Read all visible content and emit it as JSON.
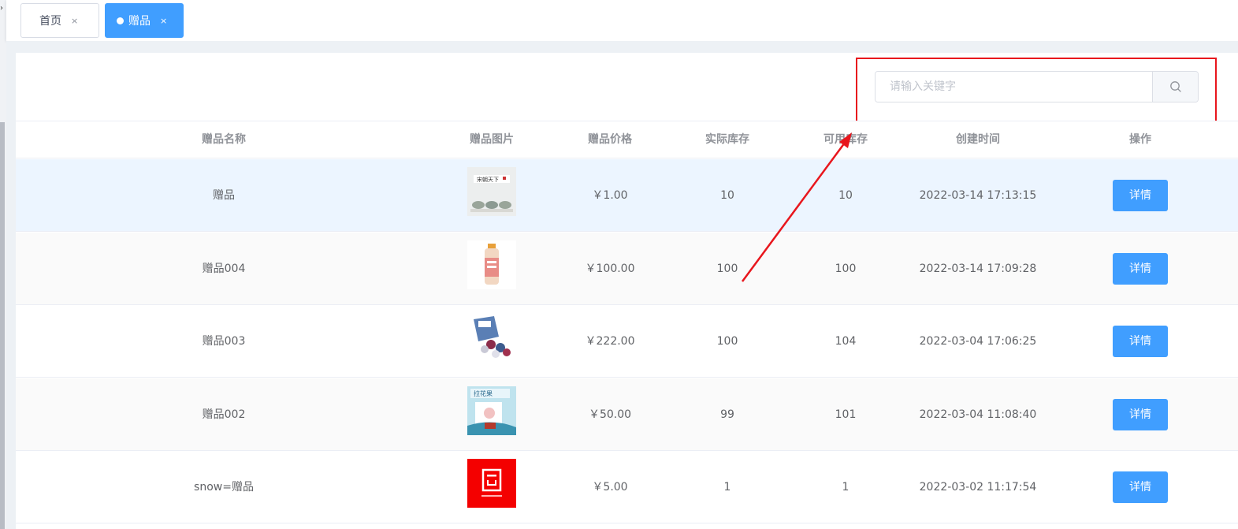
{
  "tabs": [
    {
      "label": "首页",
      "close": "×",
      "active": false
    },
    {
      "label": "赠品",
      "close": "×",
      "active": true
    }
  ],
  "search": {
    "placeholder": "请输入关键字",
    "value": "",
    "icon": "search-icon"
  },
  "table": {
    "columns": [
      "赠品名称",
      "赠品图片",
      "赠品价格",
      "实际库存",
      "可用库存",
      "创建时间",
      "操作"
    ],
    "rows": [
      {
        "name": "赠品",
        "image": "tea-cups-product-image",
        "price": "￥1.00",
        "actual_stock": "10",
        "available_stock": "10",
        "created": "2022-03-14 17:13:15",
        "action": "详情"
      },
      {
        "name": "赠品004",
        "image": "drink-bottle-product-image",
        "price": "￥100.00",
        "actual_stock": "100",
        "available_stock": "100",
        "created": "2022-03-14 17:09:28",
        "action": "详情"
      },
      {
        "name": "赠品003",
        "image": "candy-bag-product-image",
        "price": "￥222.00",
        "actual_stock": "100",
        "available_stock": "104",
        "created": "2022-03-04 17:06:25",
        "action": "详情"
      },
      {
        "name": "赠品002",
        "image": "snack-package-product-image",
        "price": "￥50.00",
        "actual_stock": "99",
        "available_stock": "101",
        "created": "2022-03-04 11:08:40",
        "action": "详情"
      },
      {
        "name": "snow=赠品",
        "image": "red-bag-product-image",
        "price": "￥5.00",
        "actual_stock": "1",
        "available_stock": "1",
        "created": "2022-03-02 11:17:54",
        "action": "详情"
      }
    ]
  },
  "colors": {
    "primary": "#409eff",
    "annotation": "#e8161d",
    "hover_row": "#ecf5ff",
    "stripe_row": "#fafafa"
  }
}
